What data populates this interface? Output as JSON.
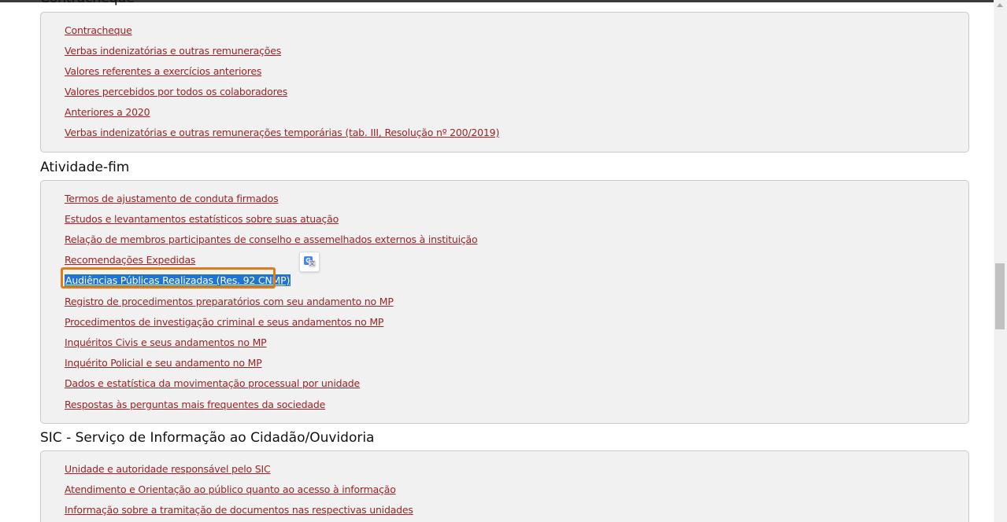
{
  "sections": {
    "contracheque": {
      "title": "Contracheque",
      "links": [
        "Contracheque",
        "Verbas indenizatórias e outras remunerações",
        "Valores referentes a exercícios anteriores",
        "Valores percebidos por todos os colaboradores",
        "Anteriores a 2020",
        "Verbas indenizatórias e outras remunerações temporárias (tab. III, Resolução nº 200/2019)"
      ]
    },
    "atividade_fim": {
      "title": "Atividade-fim",
      "links": [
        "Termos de ajustamento de conduta firmados",
        "Estudos e levantamentos estatísticos sobre suas atuação",
        "Relação de membros participantes de conselho e assemelhados externos à instituição",
        "Recomendações Expedidas",
        "Audiências Públicas Realizadas (Res. 92 CNMP)",
        "Registro de procedimentos preparatórios com seu andamento no MP",
        "Procedimentos de investigação criminal e seus andamentos no MP",
        "Inquéritos Civis e seus andamentos no MP",
        "Inquérito Policial e seu andamento no MP",
        "Dados e estatística da movimentação processual por unidade",
        "Respostas às perguntas mais frequentes da sociedade"
      ]
    },
    "sic": {
      "title": "SIC - Serviço de Informação ao Cidadão/Ouvidoria",
      "links": [
        "Unidade e autoridade responsável pelo SIC",
        "Atendimento e Orientação ao público quanto ao acesso à informação",
        "Informação sobre a tramitação de documentos nas respectivas unidades"
      ]
    }
  },
  "colors": {
    "link": "#9b2226",
    "selection": "#1f73d2",
    "focus_ring": "#e07b1a",
    "panel_bg": "#f1f1f1"
  },
  "icons": {
    "translate": "google-translate-icon"
  }
}
